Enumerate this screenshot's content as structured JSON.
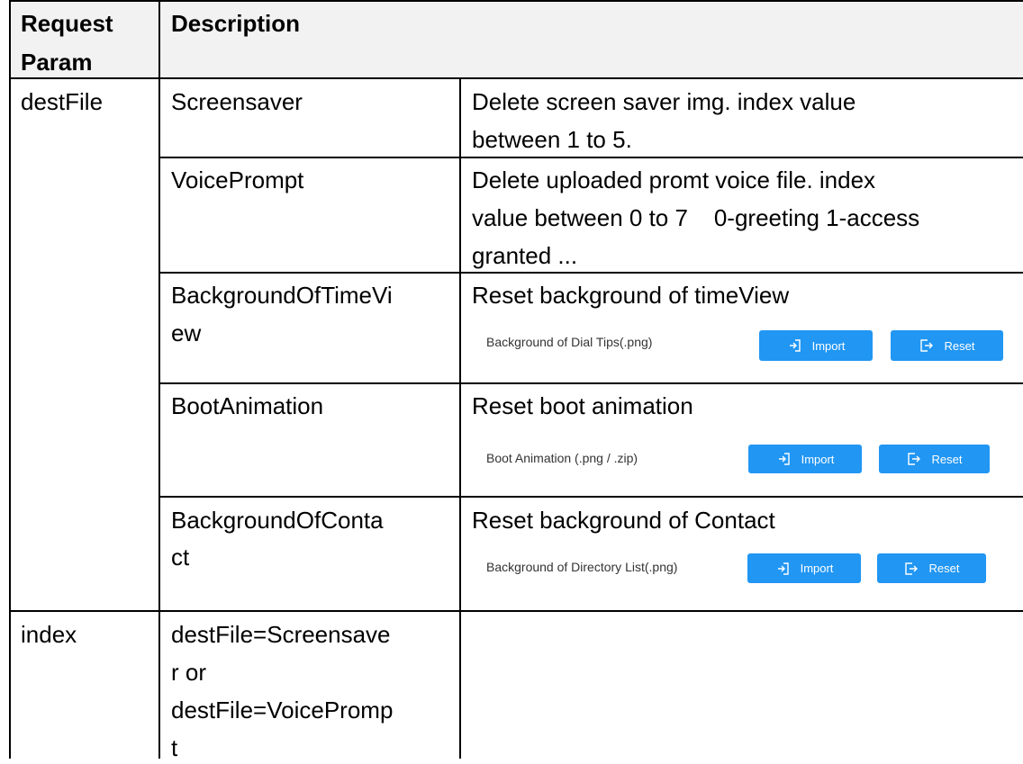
{
  "header": {
    "col1": [
      "Request",
      "Param"
    ],
    "col2": "Description"
  },
  "rows": [
    {
      "param": "destFile",
      "items": [
        {
          "name": [
            "Screensaver"
          ],
          "desc": [
            "Delete screen saver img. index value",
            "between 1 to 5."
          ]
        },
        {
          "name": [
            "VoicePrompt"
          ],
          "desc": [
            "Delete uploaded promt voice file. index",
            "value between 0 to 7    0-greeting 1-access",
            "granted ..."
          ]
        },
        {
          "name": [
            "BackgroundOfTimeVi",
            "ew"
          ],
          "desc": [
            "Reset background of timeView"
          ],
          "embed": {
            "label": "Background of Dial Tips(.png)",
            "import": "Import",
            "reset": "Reset"
          }
        },
        {
          "name": [
            "BootAnimation"
          ],
          "desc": [
            "Reset boot animation"
          ],
          "embed": {
            "label": "Boot Animation (.png / .zip)",
            "import": "Import",
            "reset": "Reset"
          }
        },
        {
          "name": [
            "BackgroundOfConta",
            "ct"
          ],
          "desc": [
            "Reset background of Contact"
          ],
          "embed": {
            "label": "Background of Directory List(.png)",
            "import": "Import",
            "reset": "Reset"
          }
        }
      ]
    },
    {
      "param": "index",
      "items": [
        {
          "name": [
            "destFile=Screensave",
            "r or",
            "destFile=VoicePromp",
            "t"
          ],
          "desc": []
        }
      ]
    }
  ],
  "colors": {
    "header_bg": "#f2f2f2",
    "border": "#000000",
    "button": "#2196f3"
  },
  "icons": {
    "import": "import-arrow-icon",
    "reset": "reset-exit-icon"
  }
}
